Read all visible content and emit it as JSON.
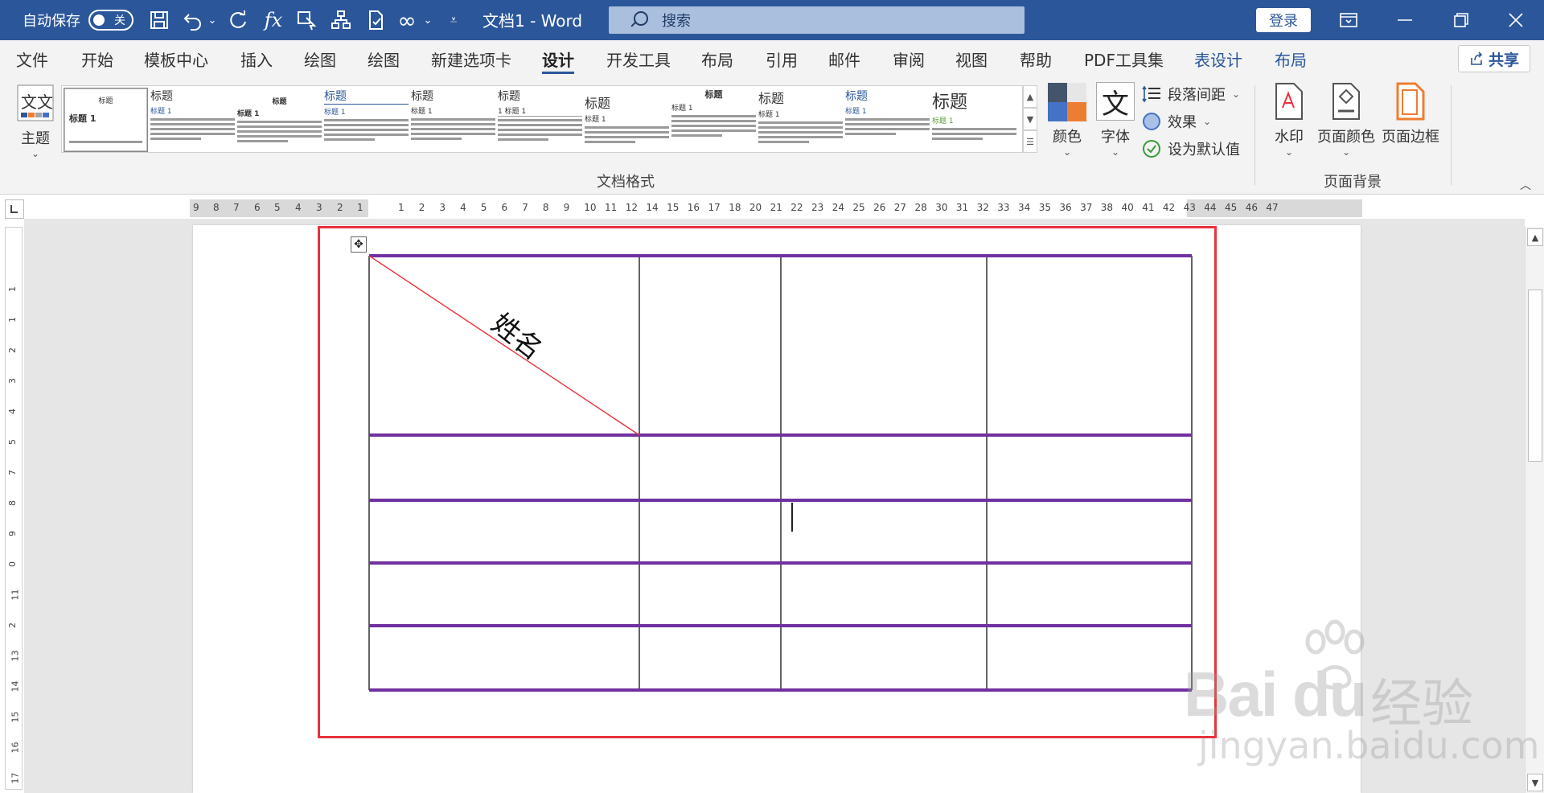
{
  "titlebar": {
    "autosave_label": "自动保存",
    "autosave_state": "关",
    "doc_title": "文档1  -  Word",
    "search_placeholder": "搜索",
    "login_label": "登录",
    "icons": [
      "save-icon",
      "undo-icon",
      "redo-icon",
      "formula-icon",
      "touch-mode-icon",
      "hierarchy-icon",
      "file-check-icon",
      "infinity-icon",
      "customize-icon"
    ]
  },
  "tabs": [
    "文件",
    "开始",
    "模板中心",
    "插入",
    "绘图",
    "绘图",
    "新建选项卡",
    "设计",
    "开发工具",
    "布局",
    "引用",
    "邮件",
    "审阅",
    "视图",
    "帮助",
    "PDF工具集",
    "表设计",
    "布局"
  ],
  "active_tab": "设计",
  "share_label": "共享",
  "ribbon": {
    "theme_label": "主题",
    "gallery": [
      {
        "title": "标题",
        "heading": "标题 1"
      },
      {
        "title": "标题",
        "heading": "标题 1"
      },
      {
        "title": "标题",
        "heading": "标题 1"
      },
      {
        "title": "标题",
        "heading": "标题 1"
      },
      {
        "title": "标题",
        "heading": "标题 1"
      },
      {
        "title": "标题",
        "heading": "1  标题 1"
      },
      {
        "title": "标题",
        "heading": "标题 1"
      },
      {
        "title": "标题",
        "heading": "标题 1"
      },
      {
        "title": "标题",
        "heading": "标题 1"
      },
      {
        "title": "标题",
        "heading": "标题 1"
      },
      {
        "title": "标题",
        "heading": "标题 1"
      }
    ],
    "colors_label": "颜色",
    "fonts_label": "字体",
    "fonts_glyph": "文",
    "paragraph_spacing_label": "段落间距",
    "effects_label": "效果",
    "set_default_label": "设为默认值",
    "doc_format_group": "文档格式",
    "watermark_label": "水印",
    "page_color_label": "页面颜色",
    "page_border_label": "页面边框",
    "page_bg_group": "页面背景"
  },
  "ruler_h_left": [
    "9",
    "8",
    "7",
    "6",
    "5",
    "4",
    "3",
    "2",
    "1"
  ],
  "ruler_h_right": [
    "1",
    "2",
    "3",
    "4",
    "5",
    "6",
    "7",
    "8",
    "9",
    "10",
    "11",
    "12",
    "14",
    "15",
    "16",
    "17",
    "18",
    "20",
    "21",
    "22",
    "23",
    "24",
    "25",
    "26",
    "27",
    "28",
    "30",
    "31",
    "32",
    "33",
    "34",
    "35",
    "36",
    "37",
    "38",
    "40",
    "41",
    "42",
    "43",
    "44",
    "45",
    "46",
    "47"
  ],
  "ruler_v": [
    "1",
    "1",
    "2",
    "3",
    "4",
    "5",
    "7",
    "8",
    "9",
    "0",
    "11",
    "2",
    "13",
    "14",
    "15",
    "16",
    "17"
  ],
  "table": {
    "header_diagonal_text": "姓名",
    "rows": 5,
    "cols": 4,
    "border_color": "#7030a0"
  },
  "highlight_color": "#e8323c",
  "watermark": {
    "main": "Bai du",
    "cn": "经验",
    "url": "jingyan.baidu.com"
  }
}
